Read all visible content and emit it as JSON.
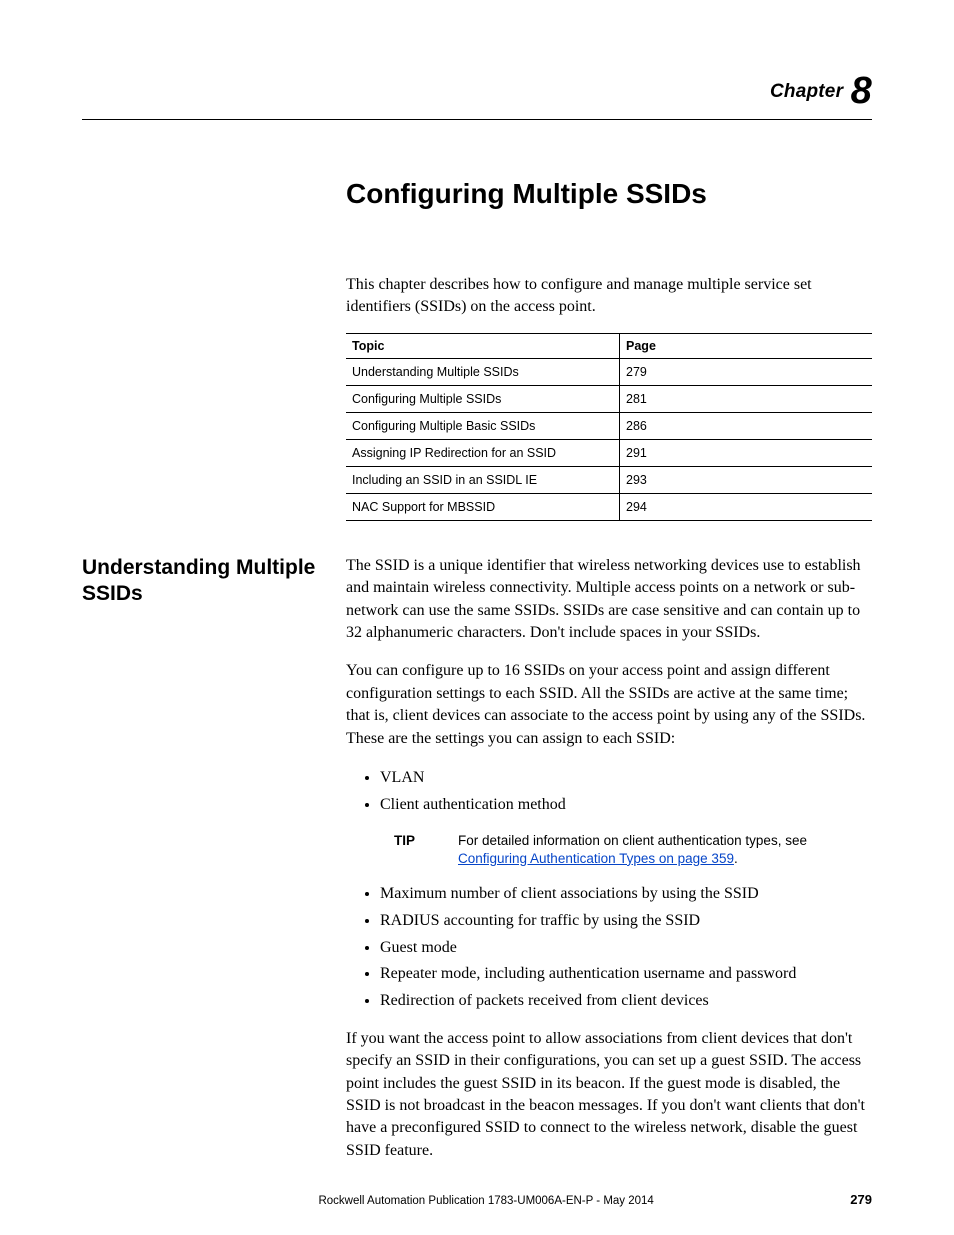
{
  "header": {
    "chapter_word": "Chapter",
    "chapter_number": "8"
  },
  "title": "Configuring Multiple SSIDs",
  "intro": "This chapter describes how to configure and manage multiple service set identifiers (SSIDs) on the access point.",
  "toc": {
    "headers": {
      "topic": "Topic",
      "page": "Page"
    },
    "rows": [
      {
        "topic": "Understanding Multiple SSIDs",
        "page": "279"
      },
      {
        "topic": "Configuring Multiple SSIDs",
        "page": "281"
      },
      {
        "topic": "Configuring Multiple Basic SSIDs",
        "page": "286"
      },
      {
        "topic": "Assigning IP Redirection for an SSID",
        "page": "291"
      },
      {
        "topic": "Including an SSID in an SSIDL IE",
        "page": "293"
      },
      {
        "topic": "NAC Support for MBSSID",
        "page": "294"
      }
    ]
  },
  "section": {
    "side_heading": "Understanding Multiple SSIDs",
    "para1": "The SSID is a unique identifier that wireless networking devices use to establish and maintain wireless connectivity. Multiple access points on a network or sub-network can use the same SSIDs. SSIDs are case sensitive and can contain up to 32 alphanumeric characters. Don't include spaces in your SSIDs.",
    "para2": "You can configure up to 16 SSIDs on your access point and assign different configuration settings to each SSID. All the SSIDs are active at the same time; that is, client devices can associate to the access point by using any of the SSIDs. These are the settings you can assign to each SSID:",
    "bullets_a": [
      "VLAN",
      "Client authentication method"
    ],
    "tip": {
      "label": "TIP",
      "text_before_link": "For detailed information on client authentication types, see ",
      "link_text": "Configuring Authentication Types on page 359",
      "text_after_link": "."
    },
    "bullets_b": [
      "Maximum number of client associations by using the SSID",
      "RADIUS accounting for traffic by using the SSID",
      "Guest mode",
      "Repeater mode, including authentication username and password",
      "Redirection of packets received from client devices"
    ],
    "para3": "If you want the access point to allow associations from client devices that don't specify an SSID in their configurations, you can set up a guest SSID. The access point includes the guest SSID in its beacon. If the guest mode is disabled, the SSID is not broadcast in the beacon messages. If you don't want clients that don't have a preconfigured SSID to connect to the wireless network, disable the guest SSID feature."
  },
  "footer": {
    "publication": "Rockwell Automation Publication 1783-UM006A-EN-P - May 2014",
    "page_number": "279"
  }
}
